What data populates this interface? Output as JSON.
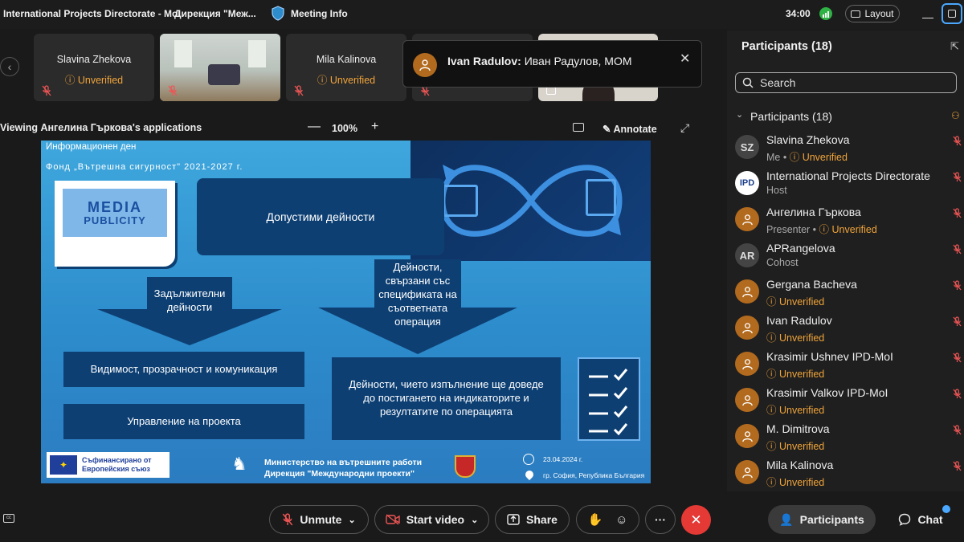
{
  "titlebar": {
    "tab1": "International Projects Directorate - MoI",
    "tab2": "Дирекция \"Меж...",
    "meeting_info": "Meeting Info",
    "timer": "34:00",
    "layout": "Layout"
  },
  "thumbnails": [
    {
      "name": "Slavina Zhekova",
      "status": "Unverified"
    },
    {
      "name": "",
      "status": ""
    },
    {
      "name": "Mila Kalinova",
      "status": "Unverified"
    }
  ],
  "toast": {
    "sender": "Ivan Radulov:",
    "message": "Иван Радулов, МОМ"
  },
  "viewing": {
    "label": "Viewing Ангелина Гъркова's applications",
    "zoom": "100%",
    "annotate": "Annotate"
  },
  "slide": {
    "header1": "Информационен ден",
    "header2": "Фонд „Вътрешна сигурност\" 2021-2027 г.",
    "logo_line1": "MEDIA",
    "logo_line2": "PUBLICITY",
    "box_main": "Допустими дейности",
    "arrow_left": "Задължителни дейности",
    "arrow_right": "Дейности, свързани със спецификата на съответната операция",
    "box_visibility": "Видимост, прозрачност и комуникация",
    "box_management": "Управление на проекта",
    "box_indicators": "Дейности, чието изпълнение ще доведе до постигането на индикаторите и резултатите по операцията",
    "eu_line1": "Съфинансирано от",
    "eu_line2": "Европейския съюз",
    "ministry_line1": "Министерство на вътрешните работи",
    "ministry_line2": "Дирекция \"Международни проекти\"",
    "date": "23.04.2024 г.",
    "place": "гр. София, Република България"
  },
  "panel": {
    "title": "Participants (18)",
    "search_placeholder": "Search",
    "group_label": "Participants (18)",
    "participants": [
      {
        "initials": "SZ",
        "name": "Slavina Zhekova",
        "role": "Me",
        "status": "Unverified"
      },
      {
        "initials": "IPD",
        "name": "International Projects Directorate",
        "role": "Host",
        "status": ""
      },
      {
        "initials": "",
        "name": "Ангелина Гъркова",
        "role": "Presenter",
        "status": "Unverified"
      },
      {
        "initials": "AR",
        "name": "APRangelova",
        "role": "Cohost",
        "status": ""
      },
      {
        "initials": "",
        "name": "Gergana Bacheva",
        "role": "",
        "status": "Unverified"
      },
      {
        "initials": "",
        "name": "Ivan Radulov",
        "role": "",
        "status": "Unverified"
      },
      {
        "initials": "",
        "name": "Krasimir Ushnev IPD-MoI",
        "role": "",
        "status": "Unverified"
      },
      {
        "initials": "",
        "name": "Krasimir Valkov IPD-MoI",
        "role": "",
        "status": "Unverified"
      },
      {
        "initials": "",
        "name": "M. Dimitrova",
        "role": "",
        "status": "Unverified"
      },
      {
        "initials": "",
        "name": "Mila Kalinova",
        "role": "",
        "status": "Unverified"
      }
    ]
  },
  "bottombar": {
    "unmute": "Unmute",
    "start_video": "Start video",
    "share": "Share",
    "participants": "Participants",
    "chat": "Chat",
    "more": "···"
  },
  "colors": {
    "accent": "#4aa8ff",
    "unverified": "#f0a43a",
    "leave": "#e53935",
    "slide_box": "#0d3f73"
  }
}
